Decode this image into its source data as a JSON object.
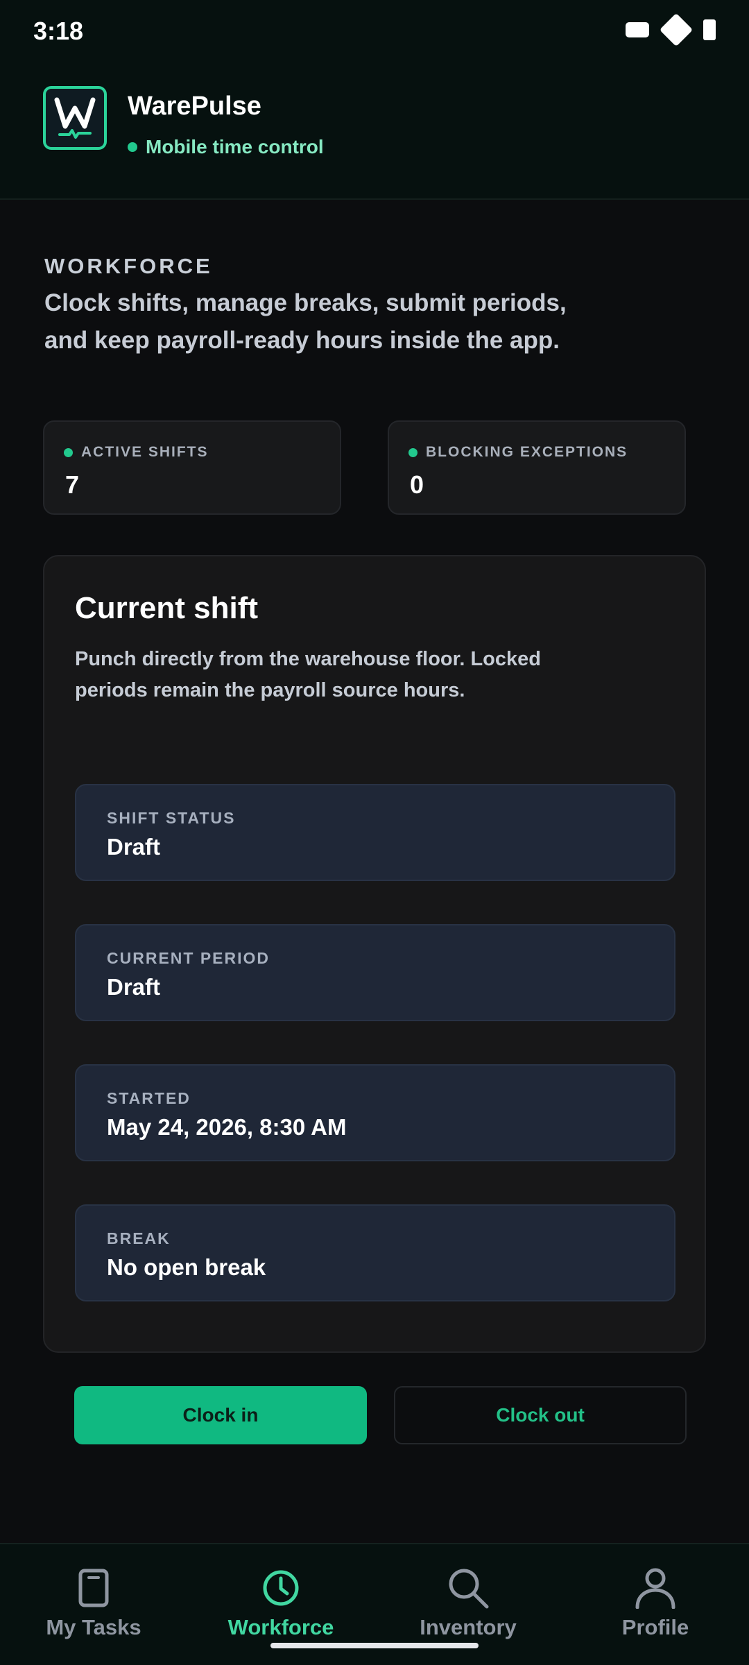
{
  "status_bar": {
    "time": "3:18"
  },
  "header": {
    "app_name": "WarePulse",
    "subtitle": "Mobile time control"
  },
  "section": {
    "kicker": "WORKFORCE",
    "description": "Clock shifts, manage breaks, submit periods, and keep payroll-ready hours inside the app."
  },
  "stats": [
    {
      "label": "ACTIVE SHIFTS",
      "value": "7"
    },
    {
      "label": "BLOCKING EXCEPTIONS",
      "value": "0"
    }
  ],
  "current_shift": {
    "title": "Current shift",
    "description": "Punch directly from the warehouse floor. Locked periods remain the payroll source hours.",
    "fields": [
      {
        "label": "SHIFT STATUS",
        "value": "Draft"
      },
      {
        "label": "CURRENT PERIOD",
        "value": "Draft"
      },
      {
        "label": "STARTED",
        "value": "May 24, 2026, 8:30 AM"
      },
      {
        "label": "BREAK",
        "value": "No open break"
      }
    ]
  },
  "actions": {
    "clock_in": "Clock in",
    "clock_out": "Clock out"
  },
  "bottom_nav": {
    "items": [
      {
        "label": "My Tasks",
        "icon": "tablet-icon"
      },
      {
        "label": "Workforce",
        "icon": "clock-icon",
        "active": true
      },
      {
        "label": "Inventory",
        "icon": "search-icon"
      },
      {
        "label": "Profile",
        "icon": "person-icon"
      }
    ]
  },
  "colors": {
    "accent": "#10b981",
    "accent_text": "#41d7a1",
    "header_bg": "#06110f",
    "card_bg": "#171718",
    "field_bg": "#1f2737"
  }
}
